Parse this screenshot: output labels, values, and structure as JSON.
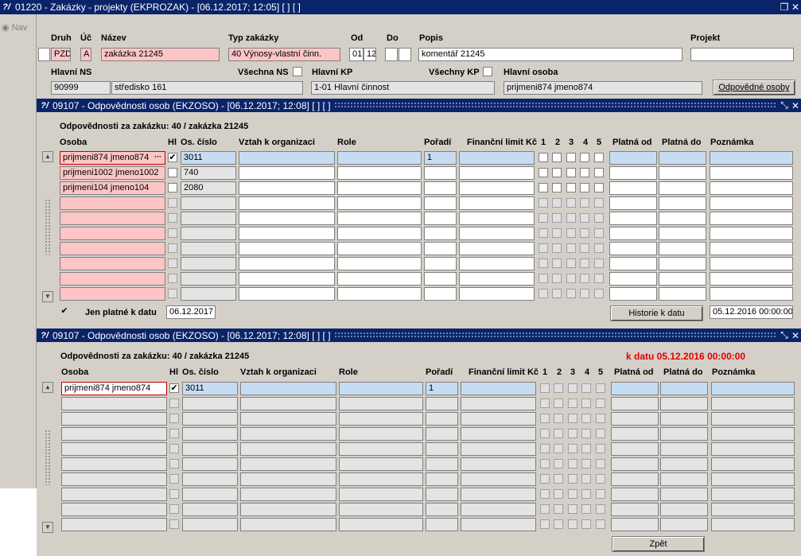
{
  "window": {
    "title": "01220 - Zakázky - projekty (EKPROZAK) - [06.12.2017; 12:05] [ ] [ ]"
  },
  "nav_label": "Nav",
  "header": {
    "labels": {
      "druh": "Druh",
      "uc": "Úč",
      "nazev": "Název",
      "typ": "Typ zakázky",
      "od": "Od",
      "do": "Do",
      "popis": "Popis",
      "projekt": "Projekt",
      "hlavni_ns": "Hlavní NS",
      "vsechna_ns": "Všechna NS",
      "hlavni_kp": "Hlavní KP",
      "vsechny_kp": "Všechny KP",
      "hlavni_osoba": "Hlavní osoba"
    },
    "values": {
      "druh": "PZD",
      "uc": "A",
      "nazev": "zakázka 21245",
      "typ": "40 Výnosy-vlastní činn.",
      "od_a": "01",
      "od_b": "12",
      "popis": "komentář 21245",
      "projekt": "",
      "ns_code": "90999",
      "ns_name": "středisko 161",
      "kp": "1-01 Hlavní činnost",
      "osoba": "prijmeni874 jmeno874"
    },
    "button_odpovedne": "Odpovědné osoby"
  },
  "panel1": {
    "title": "09107 - Odpovědnosti osob (EKZOSO) - [06.12.2017; 12:08] [ ] [ ]",
    "subtitle": "Odpovědnosti za zakázku: 40 / zakázka 21245",
    "columns": {
      "osoba": "Osoba",
      "hl": "Hl",
      "cislo": "Os. číslo",
      "vztah": "Vztah k organizaci",
      "role": "Role",
      "poradi": "Pořadí",
      "limit": "Finanční limit Kč",
      "c1": "1",
      "c2": "2",
      "c3": "3",
      "c4": "4",
      "c5": "5",
      "platna_od": "Platná od",
      "platna_do": "Platná do",
      "poznamka": "Poznámka"
    },
    "rows": [
      {
        "osoba": "prijmeni874 jmeno874",
        "hl": true,
        "cislo": "3011",
        "poradi": "1"
      },
      {
        "osoba": "prijmeni1002 jmeno1002",
        "hl": false,
        "cislo": "740",
        "poradi": ""
      },
      {
        "osoba": "prijmeni104 jmeno104",
        "hl": false,
        "cislo": "2080",
        "poradi": ""
      }
    ],
    "jen_platne_label": "Jen platné k datu",
    "jen_platne_date": "06.12.2017",
    "historie_button": "Historie k datu",
    "historie_date": "05.12.2016 00:00:00"
  },
  "panel2": {
    "title": "09107 - Odpovědnosti osob (EKZOSO) - [06.12.2017; 12:08] [ ] [ ]",
    "subtitle": "Odpovědnosti za zakázku: 40 / zakázka 21245",
    "k_datu": "k datu 05.12.2016 00:00:00",
    "rows": [
      {
        "osoba": "prijmeni874 jmeno874",
        "hl": true,
        "cislo": "3011",
        "poradi": "1"
      }
    ],
    "zpet_button": "Zpět"
  },
  "colors": {
    "titlebar": "#0a246a",
    "required": "#fdc5c5",
    "current_row": "#c6dcf3",
    "alert": "#e00000"
  }
}
